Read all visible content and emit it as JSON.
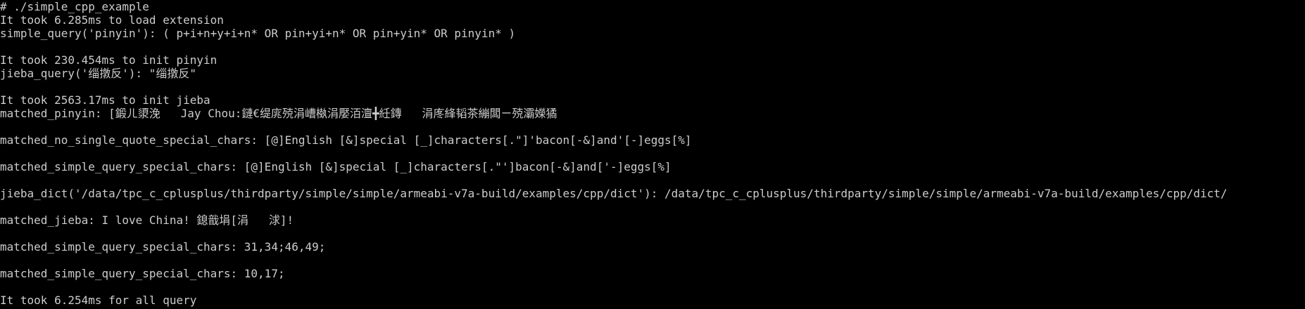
{
  "terminal": {
    "lines": [
      "# ./simple_cpp_example",
      "It took 6.285ms to load extension",
      "simple_query('pinyin'): ( p+i+n+y+i+n* OR pin+yi+n* OR pin+yin* OR pinyin* )",
      "",
      "It took 230.454ms to init pinyin",
      "jieba_query('缁撴反'): \"缁撴反\"",
      "",
      "It took 2563.17ms to init jieba",
      "matched_pinyin: [鍛ㄦ澃浼   Jay Chou:鏈€缇庣殑涓嶆槸涓嬮洦澶╋紝鏄   涓庝綘韬茶繃闆ㄧ殑灞嬫獝",
      "",
      "matched_no_single_quote_special_chars: [@]English [&]special [_]characters[.\"]'bacon[-&]and'[-]eggs[%]",
      "",
      "matched_simple_query_special_chars: [@]English [&]special [_]characters[.\"']bacon[-&]and['-]eggs[%]",
      "",
      "jieba_dict('/data/tpc_c_cplusplus/thirdparty/simple/simple/armeabi-v7a-build/examples/cpp/dict'): /data/tpc_c_cplusplus/thirdparty/simple/simple/armeabi-v7a-build/examples/cpp/dict/",
      "",
      "matched_jieba: I love China! 鎴戠埍[涓   浗]!",
      "",
      "matched_simple_query_special_chars: 31,34;46,49;",
      "",
      "matched_simple_query_special_chars: 10,17;",
      "",
      "It took 6.254ms for all query"
    ]
  }
}
